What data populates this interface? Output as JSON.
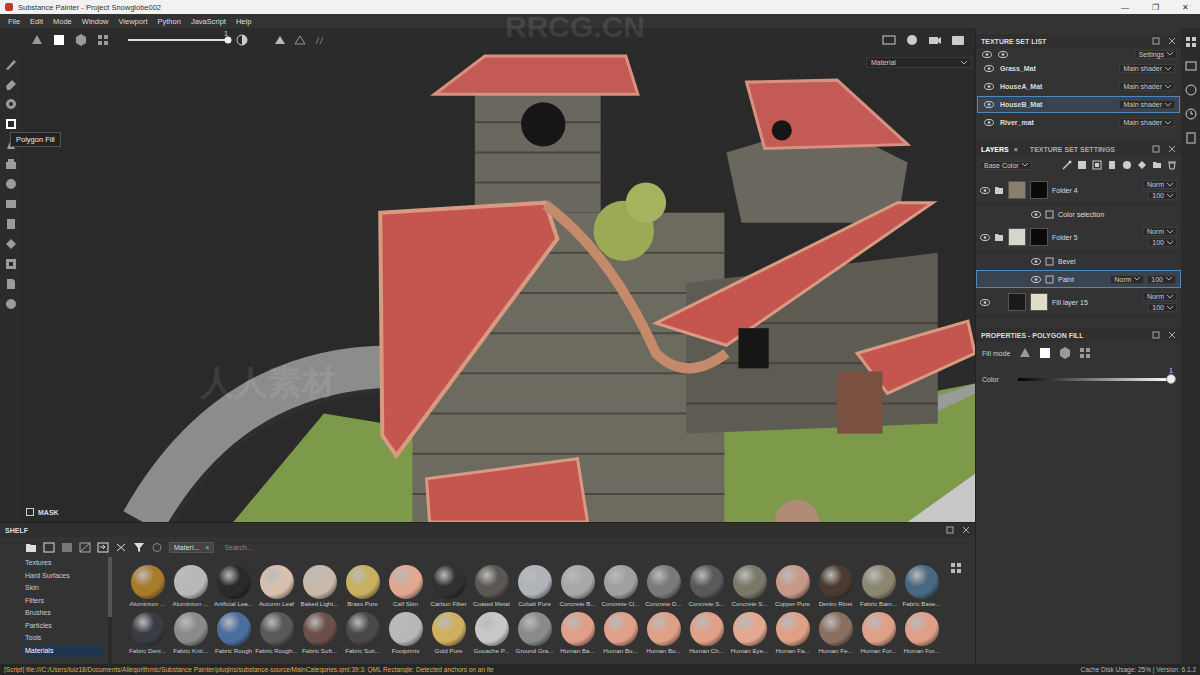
{
  "window": {
    "title": "Substance Painter - Project Snowglobe002",
    "controls": [
      "—",
      "❐",
      "✕"
    ]
  },
  "menu": [
    "File",
    "Edit",
    "Mode",
    "Window",
    "Viewport",
    "Python",
    "JavaScript",
    "Help"
  ],
  "toolbar": {
    "modes": [
      {
        "selected": false
      },
      {
        "selected": true
      },
      {
        "selected": false
      },
      {
        "selected": false
      }
    ],
    "size": {
      "reading": "1",
      "level": 1
    }
  },
  "tools": [
    {
      "selected": false
    },
    {
      "selected": false
    },
    {
      "selected": false
    },
    {
      "selected": true
    },
    {
      "selected": false
    },
    {
      "selected": false
    },
    {
      "selected": false
    },
    {
      "selected": false
    },
    {
      "selected": false
    },
    {
      "selected": false
    },
    {
      "selected": false
    },
    {
      "selected": false
    },
    {
      "selected": false
    }
  ],
  "tooltip": "Polygon Fill",
  "viewport": {
    "mode": "Material",
    "mask_label": "MASK",
    "mask_checked": false
  },
  "watermarks": [
    "RRCG.CN",
    "人人素材"
  ],
  "texture_sets": {
    "title": "TEXTURE SET LIST",
    "settings": "Settings",
    "items": [
      {
        "name": "Grass_Mat",
        "shader": "Main shader",
        "visible": true,
        "selected": false
      },
      {
        "name": "HouseA_Mat",
        "shader": "Main shader",
        "visible": true,
        "selected": false
      },
      {
        "name": "HouseB_Mat",
        "shader": "Main shader",
        "visible": true,
        "selected": true
      },
      {
        "name": "River_mat",
        "shader": "Main shader",
        "visible": true,
        "selected": false
      }
    ]
  },
  "layers": {
    "tabs": [
      {
        "label": "LAYERS",
        "selected": true,
        "closable": true
      },
      {
        "label": "TEXTURE SET SETTINGS",
        "selected": false,
        "closable": false
      }
    ],
    "close": "×",
    "channel": "Base Color",
    "items": [
      {
        "kind": "folder",
        "name": "Folder 4",
        "blend": "Norm",
        "opacity": "100",
        "visible": true,
        "selected": false,
        "thumb": "#8b7d6b",
        "mask": "#0a0a0a"
      },
      {
        "kind": "effect",
        "name": "Color selection",
        "visible": true,
        "selected": false
      },
      {
        "kind": "folder",
        "name": "Folder 5",
        "blend": "Norm",
        "opacity": "100",
        "visible": true,
        "selected": false,
        "thumb": "#d6d6ce",
        "mask": "#0a0a0a"
      },
      {
        "kind": "effect",
        "name": "Bevel",
        "visible": true,
        "selected": false
      },
      {
        "kind": "effect",
        "name": "Paint",
        "blend": "Norm",
        "opacity": "100",
        "visible": true,
        "selected": true
      },
      {
        "kind": "fill",
        "name": "Fill layer 15",
        "blend": "Norm",
        "opacity": "100",
        "visible": true,
        "selected": false,
        "thumb": "#1a1a1a",
        "mask": "#e0dcc8"
      }
    ]
  },
  "properties": {
    "title": "PROPERTIES - POLYGON FILL",
    "fill_mode_label": "Fill mode",
    "fill_modes": [
      {
        "selected": false
      },
      {
        "selected": true
      },
      {
        "selected": false
      },
      {
        "selected": false
      }
    ],
    "color_label": "Color",
    "color_reading": "1",
    "color_level": 1
  },
  "shelf": {
    "title": "SHELF",
    "filter": "Materi...",
    "filter_close": "×",
    "search_placeholder": "Search...",
    "categories": [
      {
        "label": "Textures",
        "selected": false
      },
      {
        "label": "Hard Surfaces",
        "selected": false
      },
      {
        "label": "Skin",
        "selected": false
      },
      {
        "label": "Filters",
        "selected": false
      },
      {
        "label": "Brushes",
        "selected": false
      },
      {
        "label": "Particles",
        "selected": false
      },
      {
        "label": "Tools",
        "selected": false
      },
      {
        "label": "Materials",
        "selected": true
      }
    ],
    "materials": [
      {
        "label": "Aluminium ...",
        "color": "#a87b2a"
      },
      {
        "label": "Aluminium ...",
        "color": "#b8b8b8"
      },
      {
        "label": "Artificial Lea...",
        "color": "#2a2a2a"
      },
      {
        "label": "Autumn Leaf",
        "color": "#d8c0b0"
      },
      {
        "label": "Baked Light...",
        "color": "#c8b8a8"
      },
      {
        "label": "Brass Pure",
        "color": "#c8b060"
      },
      {
        "label": "Calf Skin",
        "color": "#e0a890"
      },
      {
        "label": "Carbon Fiber",
        "color": "#303030"
      },
      {
        "label": "Coated Metal",
        "color": "#5a5850"
      },
      {
        "label": "Cobalt Pure",
        "color": "#b0b4b8"
      },
      {
        "label": "Concrete B...",
        "color": "#a8a8a8"
      },
      {
        "label": "Concrete Cl...",
        "color": "#a0a0a0"
      },
      {
        "label": "Concrete D...",
        "color": "#7a7a7a"
      },
      {
        "label": "Concrete S...",
        "color": "#5a5a5a"
      },
      {
        "label": "Concrete S...",
        "color": "#7a7868"
      },
      {
        "label": "Copper Pure",
        "color": "#c89888"
      },
      {
        "label": "Denim Rivet",
        "color": "#4a3a30"
      },
      {
        "label": "Fabric Bam...",
        "color": "#8a8670"
      },
      {
        "label": "Fabric Base...",
        "color": "#4a6880"
      },
      {
        "label": "Fabric Deni...",
        "color": "#3a3c44"
      },
      {
        "label": "Fabric Knit...",
        "color": "#8a8a88"
      },
      {
        "label": "Fabric Rough",
        "color": "#4a6ea0"
      },
      {
        "label": "Fabric Rough...",
        "color": "#5a5858"
      },
      {
        "label": "Fabric Soft...",
        "color": "#6a5048"
      },
      {
        "label": "Fabric Suit...",
        "color": "#4a4848"
      },
      {
        "label": "Footprints",
        "color": "#b8b8b8"
      },
      {
        "label": "Gold Pure",
        "color": "#d0b060"
      },
      {
        "label": "Gouache P...",
        "color": "#c8c8c8"
      },
      {
        "label": "Ground Gra...",
        "color": "#8a8a88"
      },
      {
        "label": "Human Ba...",
        "color": "#e0a088"
      },
      {
        "label": "Human Bu...",
        "color": "#e0a088"
      },
      {
        "label": "Human Bu...",
        "color": "#e0a088"
      },
      {
        "label": "Human Ch...",
        "color": "#e0a088"
      },
      {
        "label": "Human Eye...",
        "color": "#e4a890"
      },
      {
        "label": "Human Fa...",
        "color": "#e0a088"
      },
      {
        "label": "Human Fe...",
        "color": "#8a7060"
      },
      {
        "label": "Human For...",
        "color": "#e0a088"
      },
      {
        "label": "Human For...",
        "color": "#e0a088"
      }
    ]
  },
  "status": {
    "message": "[Script] file:///C:/Users/luiz18/Documents/Allegorithmic/Substance Painter/plugins/substance-source/MainCategories.qml:39:3: QML Rectangle: Detected anchors on an ite",
    "info": "Cache Disk Usage:  25% | Version: 6.1.2"
  }
}
